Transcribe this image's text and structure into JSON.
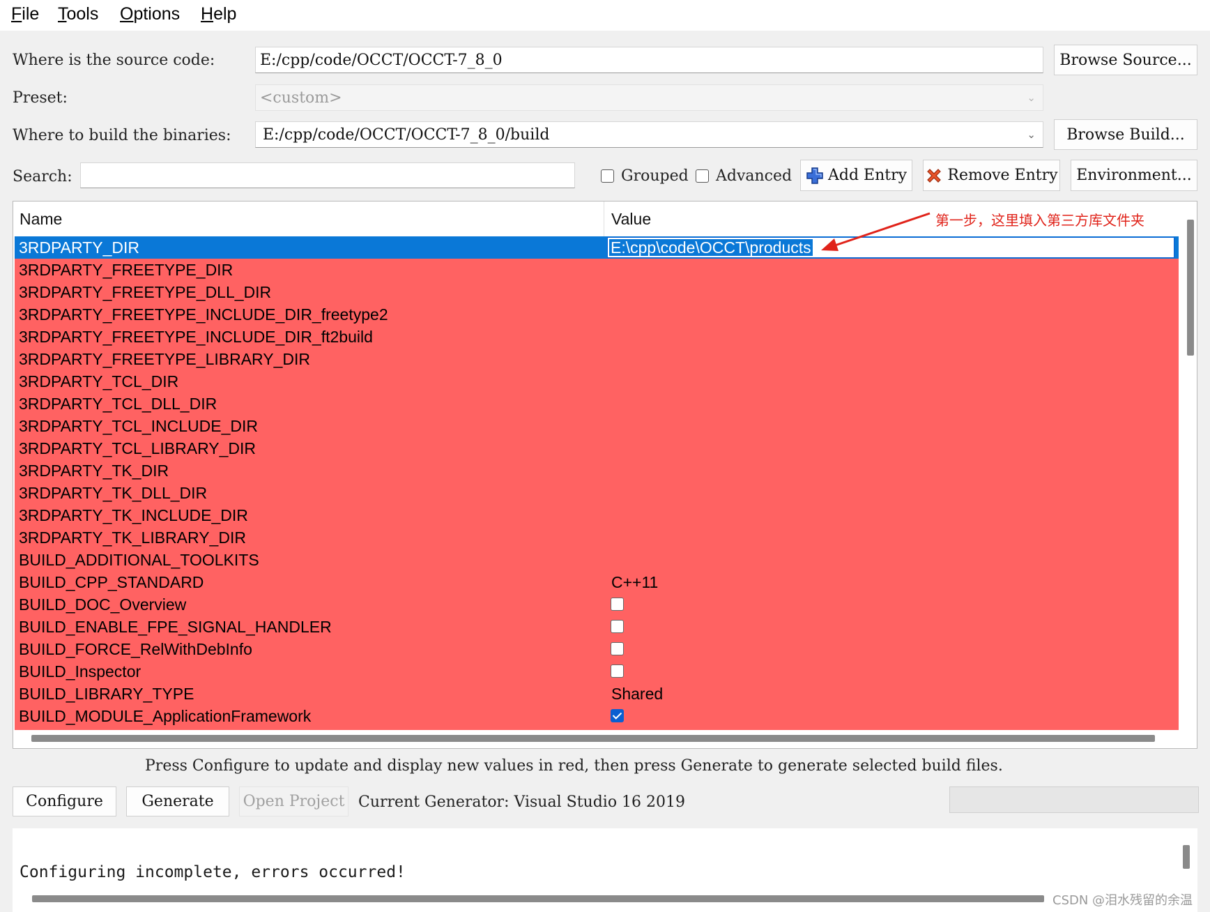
{
  "menu": [
    {
      "key": "F",
      "rest": "ile"
    },
    {
      "key": "T",
      "rest": "ools"
    },
    {
      "key": "O",
      "rest": "ptions"
    },
    {
      "key": "H",
      "rest": "elp"
    }
  ],
  "source": {
    "label": "Where is the source code:",
    "value": "E:/cpp/code/OCCT/OCCT-7_8_0",
    "browse_label": "Browse Source..."
  },
  "preset": {
    "label": "Preset:",
    "value": "<custom>"
  },
  "build": {
    "label": "Where to build the binaries:",
    "value": "E:/cpp/code/OCCT/OCCT-7_8_0/build",
    "browse_label": "Browse Build..."
  },
  "search": {
    "label": "Search:",
    "value": ""
  },
  "options": {
    "grouped_label": "Grouped",
    "grouped_checked": false,
    "advanced_label": "Advanced",
    "advanced_checked": false
  },
  "toolbar": {
    "add_entry_label": "Add Entry",
    "remove_entry_label": "Remove Entry",
    "environment_label": "Environment..."
  },
  "table": {
    "headers": {
      "name": "Name",
      "value": "Value"
    },
    "rows": [
      {
        "name": "3RDPARTY_DIR",
        "value": "E:\\cpp\\code\\OCCT\\products",
        "kind": "edit",
        "selected": true
      },
      {
        "name": "3RDPARTY_FREETYPE_DIR",
        "value": "",
        "kind": "text"
      },
      {
        "name": "3RDPARTY_FREETYPE_DLL_DIR",
        "value": "",
        "kind": "text"
      },
      {
        "name": "3RDPARTY_FREETYPE_INCLUDE_DIR_freetype2",
        "value": "",
        "kind": "text"
      },
      {
        "name": "3RDPARTY_FREETYPE_INCLUDE_DIR_ft2build",
        "value": "",
        "kind": "text"
      },
      {
        "name": "3RDPARTY_FREETYPE_LIBRARY_DIR",
        "value": "",
        "kind": "text"
      },
      {
        "name": "3RDPARTY_TCL_DIR",
        "value": "",
        "kind": "text"
      },
      {
        "name": "3RDPARTY_TCL_DLL_DIR",
        "value": "",
        "kind": "text"
      },
      {
        "name": "3RDPARTY_TCL_INCLUDE_DIR",
        "value": "",
        "kind": "text"
      },
      {
        "name": "3RDPARTY_TCL_LIBRARY_DIR",
        "value": "",
        "kind": "text"
      },
      {
        "name": "3RDPARTY_TK_DIR",
        "value": "",
        "kind": "text"
      },
      {
        "name": "3RDPARTY_TK_DLL_DIR",
        "value": "",
        "kind": "text"
      },
      {
        "name": "3RDPARTY_TK_INCLUDE_DIR",
        "value": "",
        "kind": "text"
      },
      {
        "name": "3RDPARTY_TK_LIBRARY_DIR",
        "value": "",
        "kind": "text"
      },
      {
        "name": "BUILD_ADDITIONAL_TOOLKITS",
        "value": "",
        "kind": "text"
      },
      {
        "name": "BUILD_CPP_STANDARD",
        "value": "C++11",
        "kind": "text"
      },
      {
        "name": "BUILD_DOC_Overview",
        "value": false,
        "kind": "bool"
      },
      {
        "name": "BUILD_ENABLE_FPE_SIGNAL_HANDLER",
        "value": false,
        "kind": "bool"
      },
      {
        "name": "BUILD_FORCE_RelWithDebInfo",
        "value": false,
        "kind": "bool"
      },
      {
        "name": "BUILD_Inspector",
        "value": false,
        "kind": "bool"
      },
      {
        "name": "BUILD_LIBRARY_TYPE",
        "value": "Shared",
        "kind": "text"
      },
      {
        "name": "BUILD_MODULE_ApplicationFramework",
        "value": true,
        "kind": "bool"
      }
    ]
  },
  "annotation": {
    "text": "第一步，这里填入第三方库文件夹"
  },
  "status": {
    "hint": "Press Configure to update and display new values in red, then press Generate to generate selected build files.",
    "generator": "Current Generator: Visual Studio 16 2019"
  },
  "actions": {
    "configure_label": "Configure",
    "generate_label": "Generate",
    "open_project_label": "Open Project"
  },
  "output": {
    "text": "Configuring incomplete, errors occurred!"
  },
  "watermark": "CSDN @泪水残留的余温",
  "colors": {
    "changed_row": "#ff6262",
    "selection": "#0a78d7",
    "annotation": "#e0231a"
  }
}
